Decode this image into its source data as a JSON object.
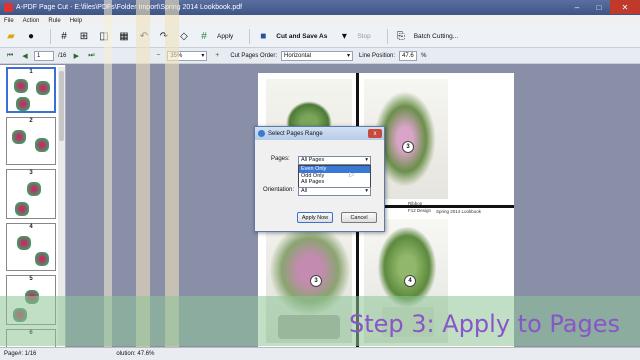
{
  "window": {
    "title": "A-PDF Page Cut - E:\\files\\PDFs\\Folder Import\\Spring 2014 Lookbook.pdf"
  },
  "menu": {
    "items": [
      "File",
      "Action",
      "Rule",
      "Help"
    ]
  },
  "toolbar": {
    "apply_label": "Apply",
    "cut_save_label": "Cut and Save As",
    "stop_label": "Stop",
    "batch_label": "Batch Cutting..."
  },
  "navbar": {
    "page_value": "1",
    "page_total": "/16",
    "zoom_value": "35%",
    "order_label": "Cut Pages Order:",
    "order_value": "Horizontal",
    "line_pos_label": "Line Position:",
    "line_pos_value": "47.6",
    "line_pos_unit": "%"
  },
  "thumbnails": {
    "numbers": [
      "1",
      "2",
      "3",
      "4",
      "5",
      "6"
    ]
  },
  "page": {
    "badges": [
      "3",
      "3",
      "4"
    ],
    "captions": {
      "ribbon": "Ribbon",
      "design": "F12 Design",
      "lookbook": "Spring 2014 Lookbook"
    }
  },
  "dialog": {
    "title": "Select Pages Range",
    "pages_label": "Pages:",
    "pages_value": "All Pages",
    "options": [
      "Even Only",
      "Odd Only",
      "All Pages"
    ],
    "highlighted_option": "Even Only",
    "orientation_label": "Orientation:",
    "orientation_value": "All",
    "apply_button": "Apply Now",
    "cancel_button": "Cancel",
    "close_glyph": "x"
  },
  "caption": {
    "text": "Step 3: Apply to Pages"
  },
  "status": {
    "page_info": "Page#: 1/16",
    "resolution": "olution: 47.6%"
  },
  "colors": {
    "caption": "#8a55c8",
    "highlight": "#3a78d6",
    "cut_line": "#111111"
  }
}
